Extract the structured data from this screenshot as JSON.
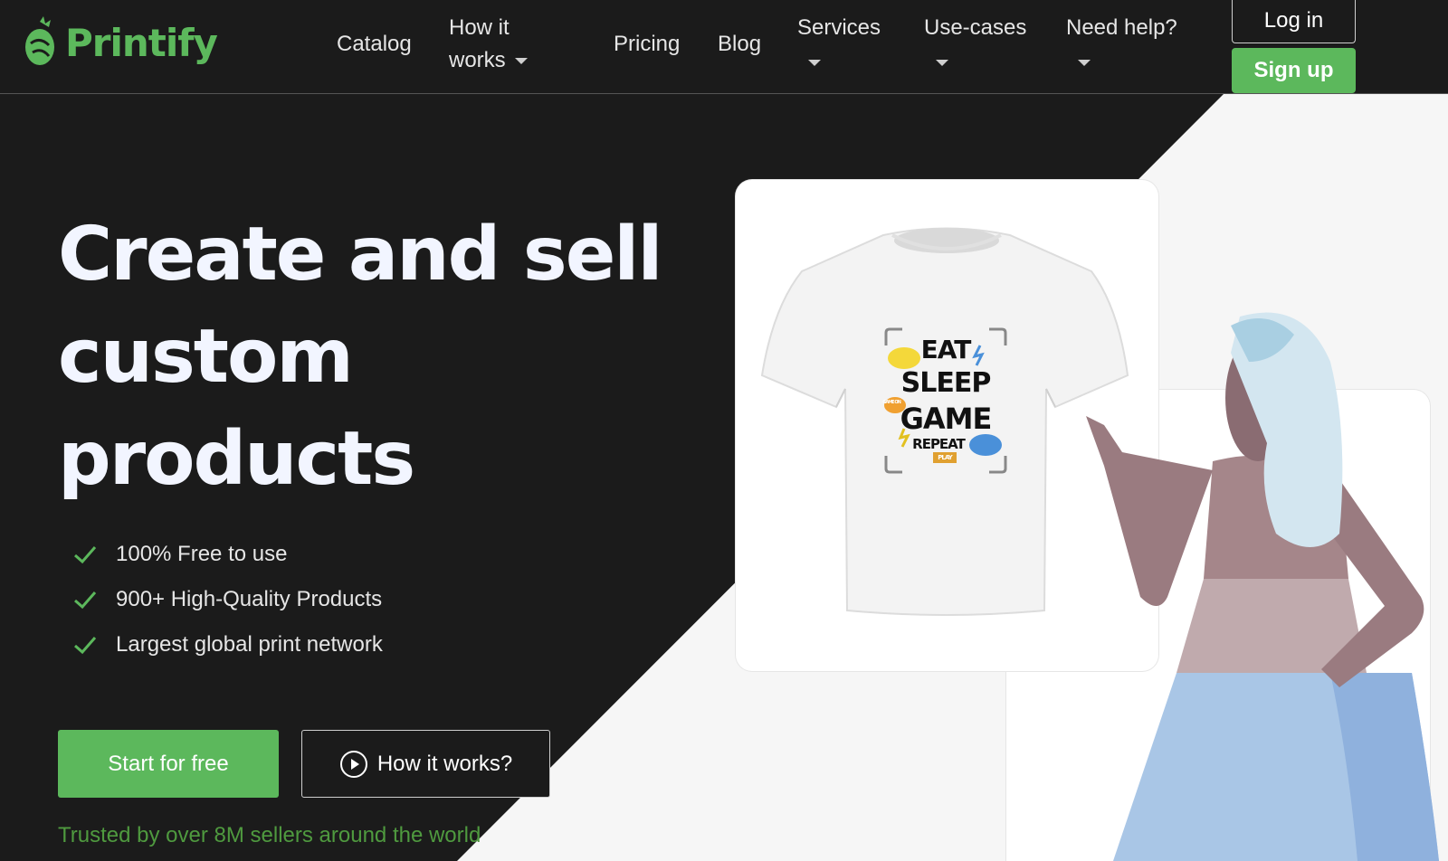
{
  "brand": {
    "name": "Printify",
    "color": "#5cb85c"
  },
  "nav": {
    "items": [
      {
        "label": "Catalog"
      },
      {
        "label_line1": "How it",
        "label_line2": "works"
      },
      {
        "label": "Pricing"
      },
      {
        "label": "Blog"
      },
      {
        "label": "Services"
      },
      {
        "label": "Use-cases"
      },
      {
        "label": "Need help?"
      }
    ],
    "login": "Log in",
    "signup": "Sign up"
  },
  "hero": {
    "title_line1": "Create and sell",
    "title_line2": "custom",
    "title_line3": "products",
    "features": [
      "100% Free to use",
      "900+ High-Quality Products",
      "Largest global print network"
    ],
    "cta_primary": "Start for free",
    "cta_secondary": "How it works?",
    "trusted": "Trusted by over 8M sellers around the world"
  },
  "product": {
    "design_lines": [
      "EAT",
      "SLEEP",
      "GAME",
      "REPEAT"
    ],
    "badge_game_on": "GAME ON",
    "badge_play": "PLAY"
  },
  "icons": {
    "logo": "printify-logo-icon",
    "check": "check-icon",
    "play": "play-circle-icon",
    "caret": "chevron-down-icon"
  },
  "colors": {
    "background": "#1b1b1b",
    "accent": "#5cb85c",
    "trusted_text": "#4f9a3f",
    "light_panel": "#f6f6f6"
  }
}
